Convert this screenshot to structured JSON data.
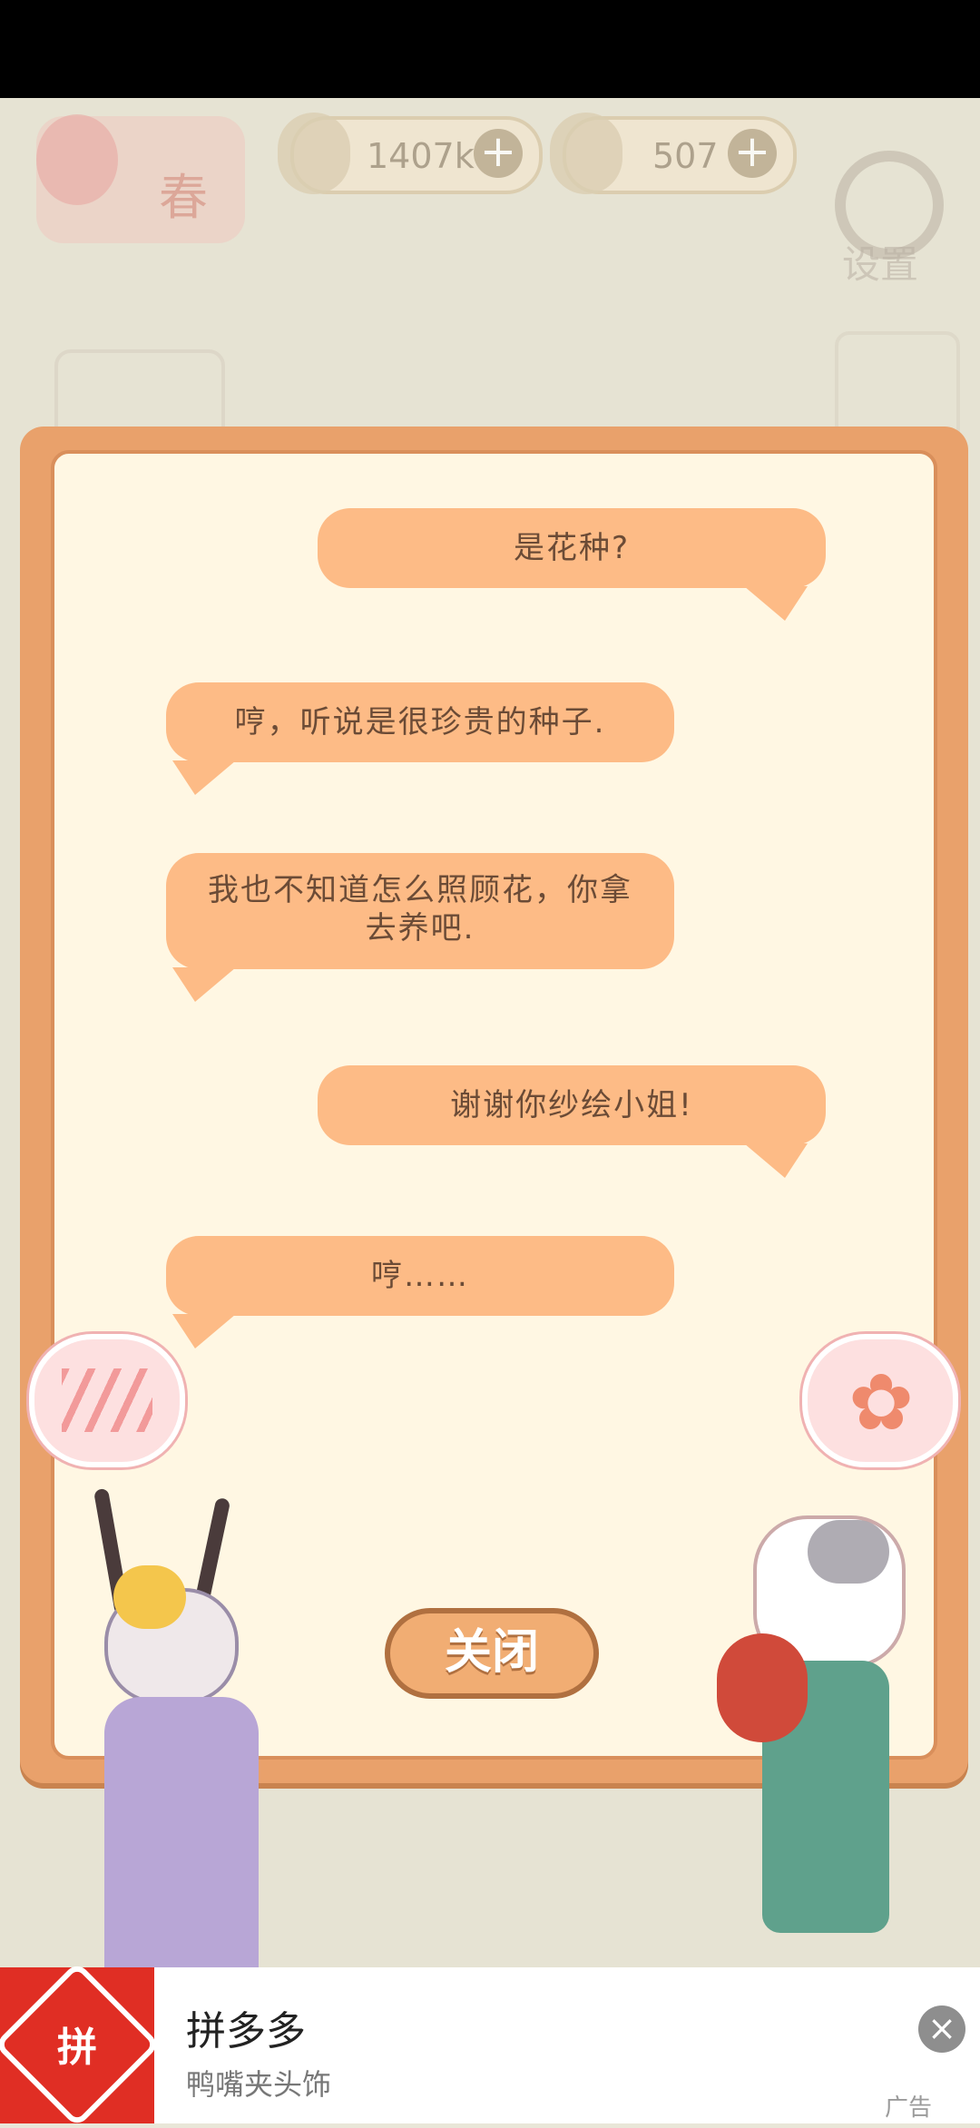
{
  "topbar": {
    "season": "春",
    "fish_amount": "1407k",
    "cheese_amount": "507",
    "settings_label": "设置"
  },
  "dialog": {
    "messages": [
      {
        "side": "right",
        "text": "是花种?"
      },
      {
        "side": "left",
        "text": "哼，听说是很珍贵的种子."
      },
      {
        "side": "left",
        "text": "我也不知道怎么照顾花，你拿去养吧."
      },
      {
        "side": "right",
        "text": "谢谢你纱绘小姐!"
      },
      {
        "side": "left",
        "text": "哼……"
      }
    ],
    "close_label": "关闭"
  },
  "ad": {
    "app_name": "拼多多",
    "subtitle": "鸭嘴夹头饰",
    "tag": "广告",
    "logo_char": "拼"
  },
  "colors": {
    "dialog_border": "#e9a16b",
    "dialog_inner": "#fff7e3",
    "bubble": "#fdbb86",
    "text": "#6b4b36"
  }
}
